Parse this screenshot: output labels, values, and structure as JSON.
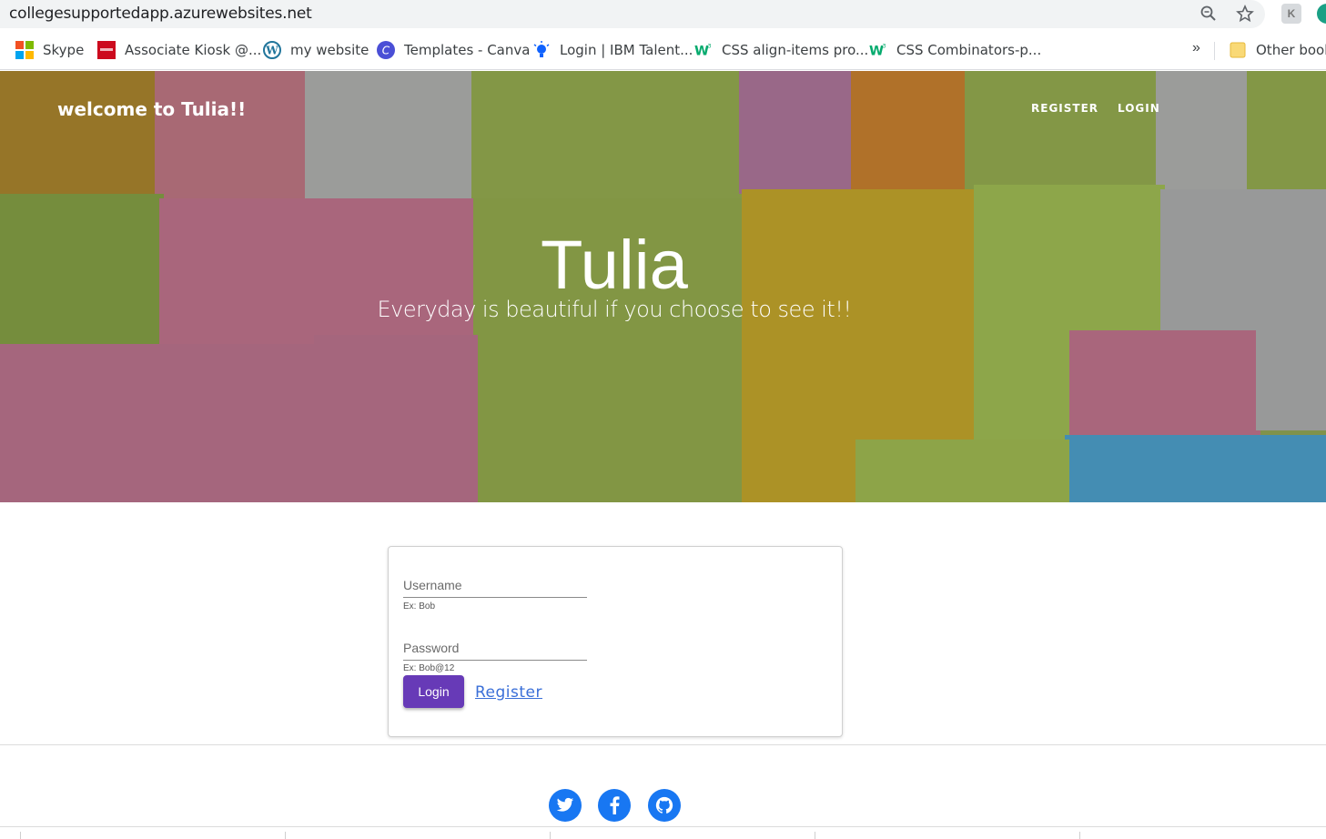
{
  "browser": {
    "url": "collegesupportedapp.azurewebsites.net",
    "icons": [
      "zoom-icon",
      "star-icon"
    ]
  },
  "bookmarks": [
    {
      "label": "Skype",
      "icon": "microsoft-icon"
    },
    {
      "label": "Associate Kiosk @...",
      "icon": "jcpenney-icon"
    },
    {
      "label": "my website",
      "icon": "wordpress-icon"
    },
    {
      "label": "Templates - Canva",
      "icon": "canva-icon"
    },
    {
      "label": "Login | IBM Talent...",
      "icon": "ibm-icon"
    },
    {
      "label": "CSS align-items pro...",
      "icon": "w3schools-icon"
    },
    {
      "label": "CSS Combinators-p...",
      "icon": "w3schools-icon"
    }
  ],
  "bookmarks_more": "»",
  "other_bookmarks": "Other bookm",
  "hero": {
    "brand": "welcome to Tulia!!",
    "nav": {
      "register": "REGISTER",
      "login": "LOGIN"
    },
    "title": "Tulia",
    "subtitle": "Everyday is beautiful if you choose to see it!!"
  },
  "login_form": {
    "username_placeholder": "Username",
    "username_hint": "Ex: Bob",
    "password_placeholder": "Password",
    "password_hint": "Ex: Bob@12",
    "login_button": "Login",
    "register_link": "Register",
    "accent": "#673ab7"
  },
  "social": [
    "twitter-icon",
    "facebook-icon",
    "github-icon"
  ],
  "social_color": "#1877f2"
}
